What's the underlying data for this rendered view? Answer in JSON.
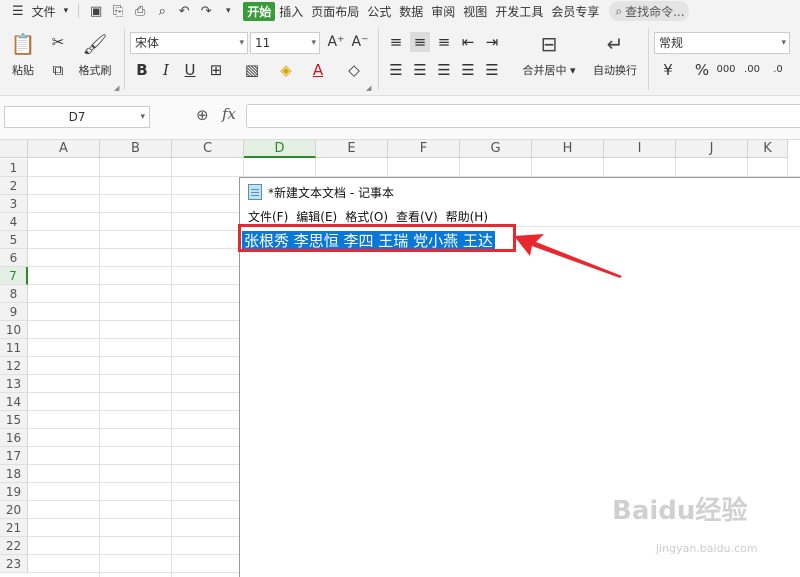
{
  "menubar": {
    "file_label": "文件",
    "tabs": [
      "开始",
      "插入",
      "页面布局",
      "公式",
      "数据",
      "审阅",
      "视图",
      "开发工具",
      "会员专享"
    ],
    "search_placeholder": "查找命令..."
  },
  "ribbon": {
    "paste": "粘贴",
    "format_painter": "格式刷",
    "font_name": "宋体",
    "font_size": "11",
    "merge_center": "合并居中",
    "wrap_text": "自动换行",
    "number_format": "常规"
  },
  "formula_bar": {
    "name_box": "D7",
    "fx": "fx",
    "content": ""
  },
  "sheet": {
    "columns": [
      "A",
      "B",
      "C",
      "D",
      "E",
      "F",
      "G",
      "H",
      "I",
      "J",
      "K"
    ],
    "rows": [
      "1",
      "2",
      "3",
      "4",
      "5",
      "6",
      "7",
      "8",
      "9",
      "10",
      "11",
      "12",
      "13",
      "14",
      "15",
      "16",
      "17",
      "18",
      "19",
      "20",
      "21",
      "22",
      "23"
    ],
    "active_column": "D",
    "active_row": "7"
  },
  "notepad": {
    "title": "*新建文本文档 - 记事本",
    "menu": [
      "文件(F)",
      "编辑(E)",
      "格式(O)",
      "查看(V)",
      "帮助(H)"
    ],
    "content": "张根秀 李思恒 李四 王瑞 党小燕 王达"
  },
  "watermark": {
    "brand": "Baidu经验",
    "url": "jingyan.baidu.com"
  },
  "colors": {
    "accent_green": "#3a9b3a",
    "selection_blue": "#0a78d6",
    "annotation_red": "#e8272e"
  }
}
